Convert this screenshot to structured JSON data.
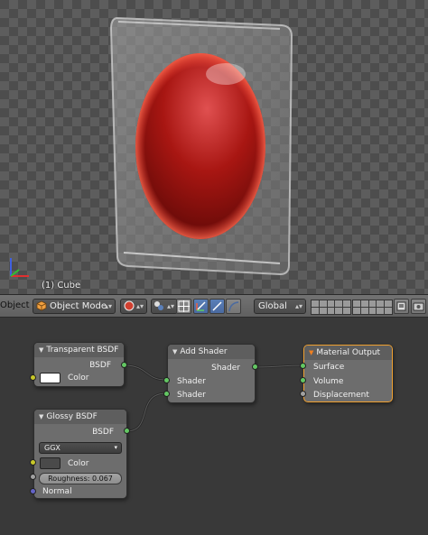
{
  "viewport": {
    "object_label": "(1) Cube"
  },
  "header": {
    "editor_label": "Object",
    "mode_dropdown": "Object Mode",
    "orientation_dropdown": "Global"
  },
  "nodes": {
    "transparent_bsdf": {
      "title": "Transparent BSDF",
      "output": "BSDF",
      "color_label": "Color",
      "color_value": "#ffffff"
    },
    "glossy_bsdf": {
      "title": "Glossy BSDF",
      "output": "BSDF",
      "distribution": "GGX",
      "color_label": "Color",
      "color_value": "#4a4a4a",
      "roughness_text": "Roughness: 0.067",
      "normal_label": "Normal"
    },
    "add_shader": {
      "title": "Add Shader",
      "output": "Shader",
      "input_1": "Shader",
      "input_2": "Shader"
    },
    "material_output": {
      "title": "Material Output",
      "input_surface": "Surface",
      "input_volume": "Volume",
      "input_displacement": "Displacement"
    }
  },
  "colors": {
    "socket_shader": "#63c763",
    "socket_color": "#c7c729",
    "socket_float": "#a1a1a1",
    "socket_vector": "#6363c7",
    "selected_outline": "#f0a030",
    "red_sphere": "#c0201a"
  }
}
